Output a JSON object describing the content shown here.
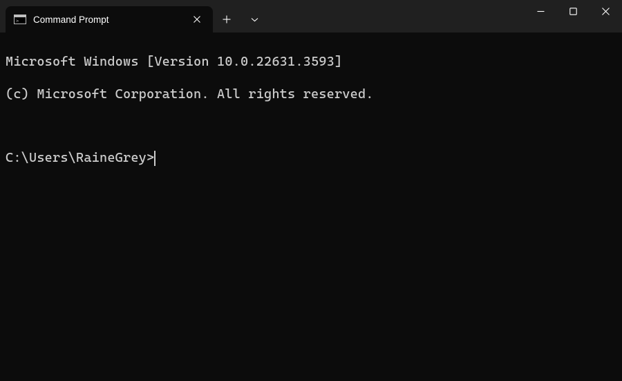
{
  "tab": {
    "title": "Command Prompt"
  },
  "terminal": {
    "line1": "Microsoft Windows [Version 10.0.22631.3593]",
    "line2": "(c) Microsoft Corporation. All rights reserved.",
    "prompt": "C:\\Users\\RaineGrey>"
  }
}
